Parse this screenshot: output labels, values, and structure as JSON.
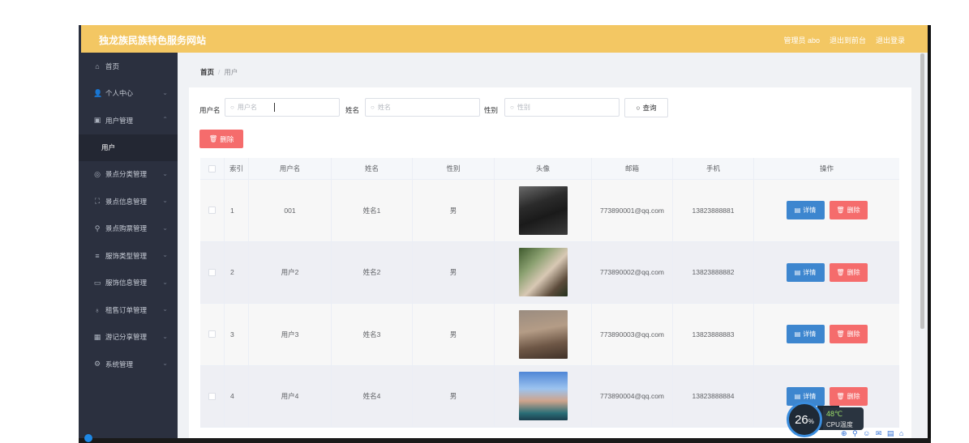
{
  "app": {
    "title": "独龙族民族特色服务网站",
    "top_links": [
      "管理员 abo",
      "退出到前台",
      "退出登录"
    ],
    "accent_color": "#f3c763",
    "sidebar_color": "#2b303f"
  },
  "sidebar": {
    "items": [
      {
        "label": "首页",
        "icon": "home-icon",
        "glyph": "⌂",
        "has_chevron": false
      },
      {
        "label": "个人中心",
        "icon": "user-icon",
        "glyph": "👤",
        "has_chevron": true
      },
      {
        "label": "用户管理",
        "icon": "document-icon",
        "glyph": "▣",
        "has_chevron": true,
        "expanded": true
      },
      {
        "label": "景点分类管理",
        "icon": "circle-icon",
        "glyph": "◎",
        "has_chevron": true
      },
      {
        "label": "景点信息管理",
        "icon": "frame-icon",
        "glyph": "⛶",
        "has_chevron": true
      },
      {
        "label": "景点购票管理",
        "icon": "location-icon",
        "glyph": "⚲",
        "has_chevron": true
      },
      {
        "label": "服饰类型管理",
        "icon": "list-icon",
        "glyph": "≡",
        "has_chevron": true
      },
      {
        "label": "服饰信息管理",
        "icon": "chat-icon",
        "glyph": "▭",
        "has_chevron": true
      },
      {
        "label": "租售订单管理",
        "icon": "microphone-icon",
        "glyph": "♁",
        "has_chevron": true
      },
      {
        "label": "游记分享管理",
        "icon": "grid-icon",
        "glyph": "▦",
        "has_chevron": true
      },
      {
        "label": "系统管理",
        "icon": "settings-icon",
        "glyph": "⚙",
        "has_chevron": true
      }
    ],
    "sub_item": "用户"
  },
  "breadcrumb": {
    "home": "首页",
    "sep": "/",
    "current": "用户"
  },
  "filters": {
    "username_label": "用户名",
    "username_placeholder": "用户名",
    "name_label": "姓名",
    "name_placeholder": "姓名",
    "gender_label": "性别",
    "gender_placeholder": "性别",
    "search_button": "查询",
    "delete_button": "删除"
  },
  "table": {
    "headers": [
      "",
      "索引",
      "用户名",
      "姓名",
      "性别",
      "头像",
      "邮箱",
      "手机",
      "操作"
    ],
    "rows": [
      {
        "index": "1",
        "username": "001",
        "name": "姓名1",
        "gender": "男",
        "avatar": "av1",
        "email": "773890001@qq.com",
        "phone": "13823888881"
      },
      {
        "index": "2",
        "username": "用户2",
        "name": "姓名2",
        "gender": "男",
        "avatar": "av2",
        "email": "773890002@qq.com",
        "phone": "13823888882"
      },
      {
        "index": "3",
        "username": "用户3",
        "name": "姓名3",
        "gender": "男",
        "avatar": "av3",
        "email": "773890003@qq.com",
        "phone": "13823888883"
      },
      {
        "index": "4",
        "username": "用户4",
        "name": "姓名4",
        "gender": "男",
        "avatar": "av4",
        "email": "773890004@qq.com",
        "phone": "13823888884"
      }
    ],
    "detail_button": "详情",
    "delete_button": "删除"
  },
  "widget": {
    "cpu_percent": "26",
    "percent_sign": "%",
    "temperature": "48℃",
    "temp_label": "CPU温度"
  }
}
